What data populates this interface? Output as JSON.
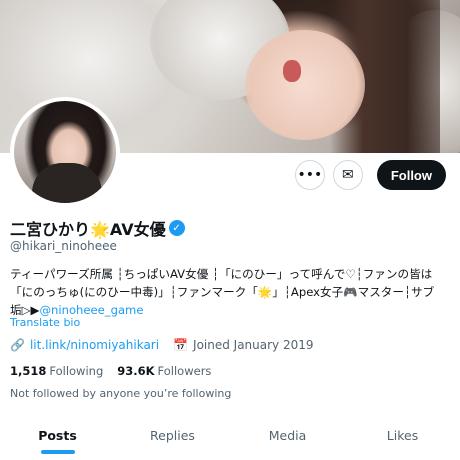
{
  "profile": {
    "display_name": "二宮ひかり🌟AV女優",
    "handle": "@hikari_ninoheee",
    "verified_icon": "verified-badge-icon",
    "bio_lines": [
      "ティーパワーズ所属 ┆ちっぱいAV女優 ┆「にのひー」って呼んで♡┆ファンの皆は",
      "「にのっちゅ(にのひー中毒)」┆ファンマーク「🌟」┆Apex女子🎮マスター┆サブ",
      "垢▷▶"
    ],
    "bio_mention": "@ninoheee_game",
    "translate_label": "Translate bio",
    "website": "lit.link/ninomiyahikari",
    "joined": "Joined January 2019",
    "following_count": "1,518",
    "following_label": "Following",
    "followers_count": "93.6K",
    "followers_label": "Followers",
    "not_followed": "Not followed by anyone you’re following"
  },
  "actions": {
    "more_icon": "•••",
    "message_icon": "✉",
    "follow_label": "Follow"
  },
  "tabs": [
    {
      "label": "Posts",
      "active": true
    },
    {
      "label": "Replies",
      "active": false
    },
    {
      "label": "Media",
      "active": false
    },
    {
      "label": "Likes",
      "active": false
    }
  ],
  "colors": {
    "accent": "#1d9bf0",
    "text": "#0f1419",
    "secondary": "#536471"
  }
}
